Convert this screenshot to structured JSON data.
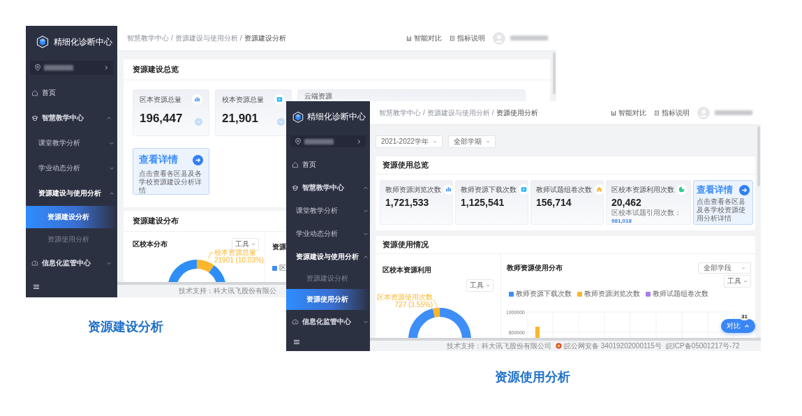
{
  "back_window": {
    "sidebar": {
      "title": "精细化诊断中心",
      "items": [
        {
          "label": "首页",
          "selected": false
        },
        {
          "label": "智慧教学中心",
          "selected": false,
          "expanded": true,
          "children": [
            {
              "label": "课堂教学分析",
              "selected": false,
              "expanded": false
            },
            {
              "label": "学业动态分析",
              "selected": false,
              "expanded": false
            },
            {
              "label": "资源建设与使用分析",
              "selected": false,
              "expanded": true,
              "children": [
                {
                  "label": "资源建设分析",
                  "selected": true
                },
                {
                  "label": "资源使用分析",
                  "selected": false
                }
              ]
            }
          ]
        },
        {
          "label": "信息化监管中心",
          "selected": false,
          "expanded": false
        }
      ]
    },
    "breadcrumb": [
      "智慧教学中心",
      "/",
      "资源建设与使用分析",
      "/",
      "资源建设分析"
    ],
    "actions": [
      "智能对比",
      "指标说明"
    ],
    "overview": {
      "title": "资源建设总览",
      "stats": [
        {
          "label": "区本资源总量",
          "value": "196,447"
        },
        {
          "label": "校本资源总量",
          "value": "21,901"
        },
        {
          "label": "云端资源"
        }
      ],
      "detail": {
        "title": "查看详情",
        "text": "点击查看各区县及各学校资源建设分析详情"
      }
    },
    "distribution": {
      "title": "资源建设分布",
      "panels": [
        {
          "title": "区校本分布",
          "tool": "工具",
          "callout": [
            "校本资源总量",
            "21901 (10.03%)"
          ]
        },
        {
          "title": "资源",
          "legend": [
            "区"
          ]
        }
      ]
    },
    "footer": "技术支持：科大讯飞股份有限公"
  },
  "front_window": {
    "sidebar": {
      "title": "精细化诊断中心",
      "items": [
        {
          "label": "首页",
          "selected": false
        },
        {
          "label": "智慧教学中心",
          "selected": false,
          "expanded": true,
          "children": [
            {
              "label": "课堂教学分析",
              "selected": false,
              "expanded": false
            },
            {
              "label": "学业动态分析",
              "selected": false,
              "expanded": false
            },
            {
              "label": "资源建设与使用分析",
              "selected": false,
              "expanded": true,
              "children": [
                {
                  "label": "资源建设分析",
                  "selected": false
                },
                {
                  "label": "资源使用分析",
                  "selected": true
                }
              ]
            }
          ]
        },
        {
          "label": "信息化监管中心",
          "selected": false,
          "expanded": false
        }
      ]
    },
    "breadcrumb": [
      "智慧教学中心",
      "/",
      "资源建设与使用分析",
      "/",
      "资源使用分析"
    ],
    "actions": [
      "智能对比",
      "指标说明"
    ],
    "filters": [
      "2021-2022学年",
      "全部学期"
    ],
    "overview": {
      "title": "资源使用总览",
      "stats": [
        {
          "label": "教师资源浏览次数",
          "value": "1,721,533"
        },
        {
          "label": "教师资源下载次数",
          "value": "1,125,541"
        },
        {
          "label": "教师试题组卷次数",
          "value": "156,714"
        },
        {
          "label": "区校本资源利用次数",
          "value": "20,462",
          "sub_label": "区校本试题引用次数：",
          "sub_value": "981,018"
        }
      ],
      "detail": {
        "title": "查看详情",
        "text": "点击查看各区县及各学校资源使用分析详情"
      }
    },
    "usage": {
      "title": "资源使用情况",
      "left": {
        "title": "区校本资源利用",
        "tool": "工具",
        "callout": [
          "区本资源使用次数",
          "727 (3.55%)"
        ]
      },
      "right": {
        "title": "教师资源使用分布",
        "filter": "全部学段",
        "tool": "工具",
        "chart_data": {
          "type": "bar",
          "ylim": [
            0,
            1000000
          ],
          "yticks": [
            800000,
            1000000
          ],
          "series": [
            {
              "name": "教师资源下载次数",
              "color": "#3e8ef7",
              "values": [
                null
              ]
            },
            {
              "name": "教师资源浏览次数",
              "color": "#fbb62c",
              "values": [
                855000
              ]
            },
            {
              "name": "教师试题组卷次数",
              "color": "#a97ee9",
              "values": [
                null
              ]
            }
          ]
        }
      }
    },
    "compare_button": {
      "label": "对比",
      "badge": "31"
    },
    "footer": [
      "技术支持：科大讯飞股份有限公司",
      "皖公网安备 34019202000115号",
      "皖ICP备05001217号-72"
    ]
  },
  "captions": [
    "资源建设分析",
    "资源使用分析"
  ]
}
